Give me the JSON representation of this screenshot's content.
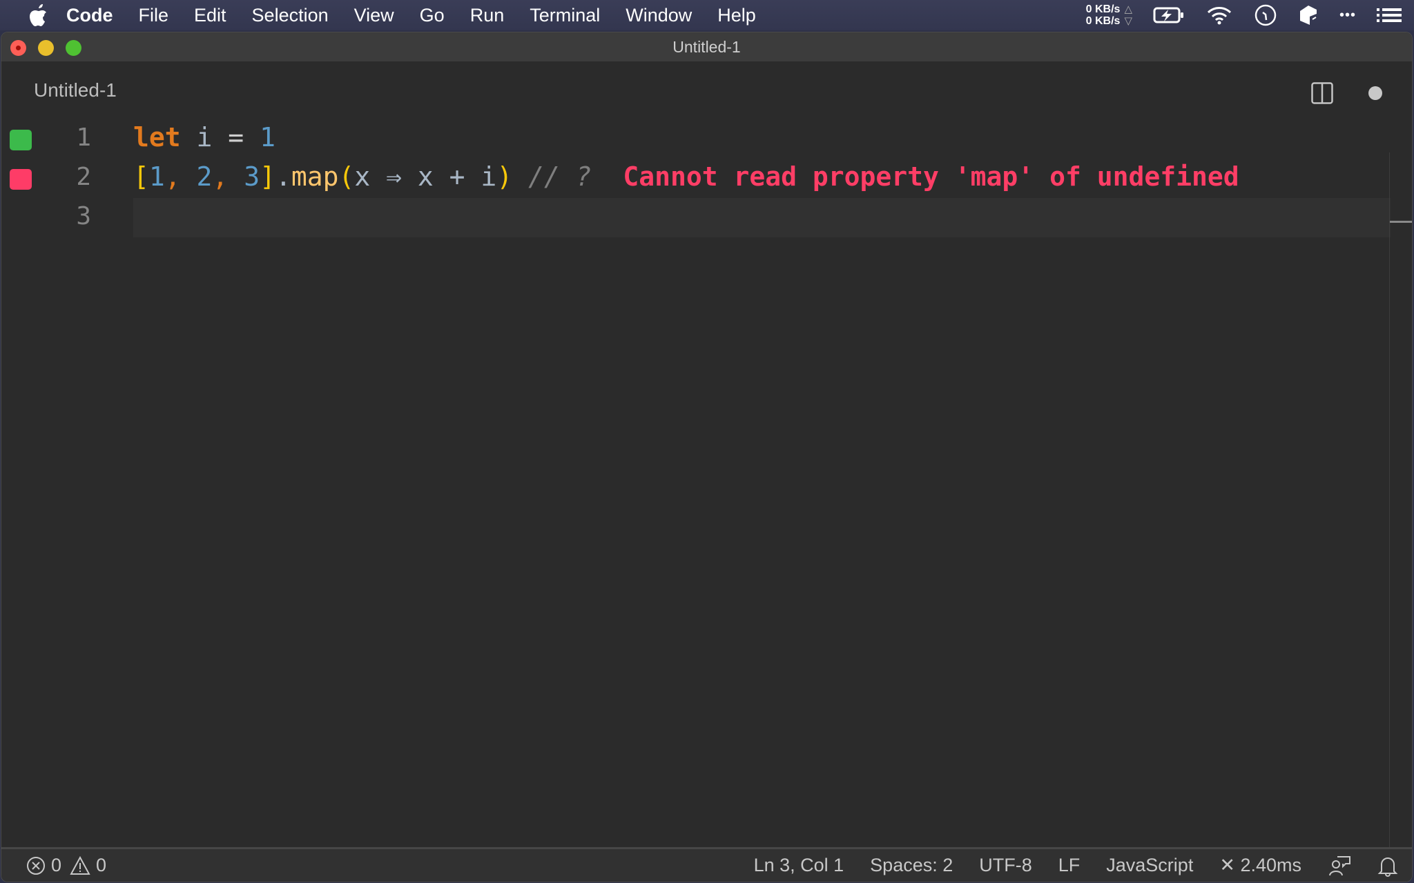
{
  "menubar": {
    "app_name": "Code",
    "items": [
      "File",
      "Edit",
      "Selection",
      "View",
      "Go",
      "Run",
      "Terminal",
      "Window",
      "Help"
    ],
    "net_up": "0 KB/s",
    "net_down": "0 KB/s",
    "net_up_arrow": "△",
    "net_down_arrow": "▽",
    "tray_icons": [
      "battery-charging-icon",
      "wifi-icon",
      "clock-icon",
      "cube-icon",
      "more-icon",
      "list-icon"
    ],
    "more_glyph": "•••"
  },
  "window": {
    "title": "Untitled-1"
  },
  "tab": {
    "label": "Untitled-1",
    "dirty": true
  },
  "editor": {
    "lines": [
      {
        "number": "1",
        "status": "ok",
        "tokens": [
          {
            "text": "let",
            "type": "kw"
          },
          {
            "text": " ",
            "type": "ws"
          },
          {
            "text": "i",
            "type": "var"
          },
          {
            "text": " = ",
            "type": "op"
          },
          {
            "text": "1",
            "type": "num"
          }
        ]
      },
      {
        "number": "2",
        "status": "error",
        "tokens": [
          {
            "text": "[",
            "type": "brk"
          },
          {
            "text": "1",
            "type": "num"
          },
          {
            "text": ", ",
            "type": "comma"
          },
          {
            "text": "2",
            "type": "num"
          },
          {
            "text": ", ",
            "type": "comma"
          },
          {
            "text": "3",
            "type": "num"
          },
          {
            "text": "]",
            "type": "brk"
          },
          {
            "text": ".",
            "type": "punct"
          },
          {
            "text": "map",
            "type": "fn"
          },
          {
            "text": "(",
            "type": "brk"
          },
          {
            "text": "x ⇒ x + i",
            "type": "var"
          },
          {
            "text": ")",
            "type": "brk"
          },
          {
            "text": " // ? ",
            "type": "comment"
          },
          {
            "text": " Cannot read property 'map' of undefined",
            "type": "err"
          }
        ]
      },
      {
        "number": "3",
        "status": "none",
        "current": true,
        "tokens": []
      }
    ]
  },
  "statusbar": {
    "errors": "0",
    "warnings": "0",
    "cursor": "Ln 3, Col 1",
    "indent": "Spaces: 2",
    "encoding": "UTF-8",
    "eol": "LF",
    "language": "JavaScript",
    "timing": "✕ 2.40ms"
  },
  "colors": {
    "ok": "#3cba4b",
    "error": "#fe3c67",
    "keyword": "#e27a1e",
    "number": "#5b9bc9",
    "bracket": "#f8c80a",
    "function": "#ffc66d"
  }
}
